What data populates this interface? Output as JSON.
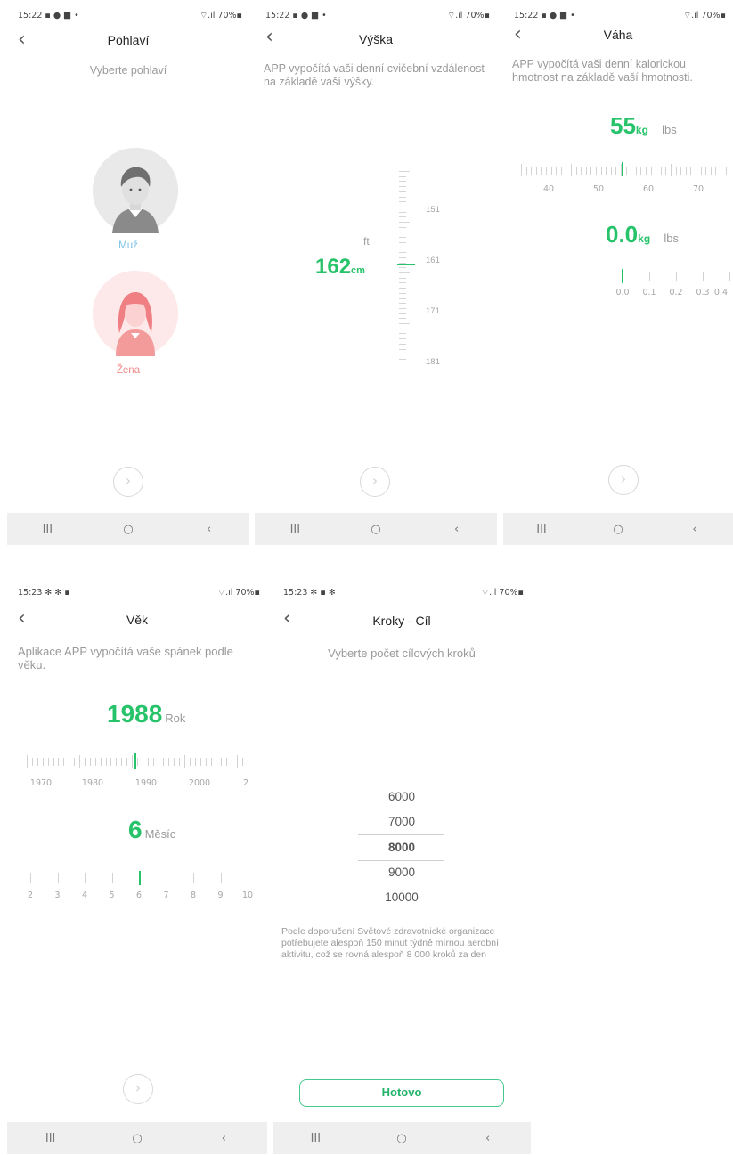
{
  "colors": {
    "accent": "#27c36a",
    "male": "#7fc2e6",
    "female": "#f08a8a",
    "nav_bg": "#efefef"
  },
  "icons": {
    "back": "chevron-left-icon",
    "next": "chevron-right-circle-icon",
    "nav_recent": "recent-apps-icon",
    "nav_home": "home-icon",
    "nav_back": "back-icon"
  },
  "nav": {
    "recent": "III",
    "home": "○",
    "back": "‹"
  },
  "next_glyph": "›",
  "back_glyph": "‹",
  "screens": {
    "gender": {
      "status_time": "15:22 ▪ ● ■ •",
      "status_right": "⌔.ıl 70%▪",
      "title": "Pohlaví",
      "description": "Vyberte pohlaví",
      "male_label": "Muž",
      "female_label": "Žena"
    },
    "height": {
      "status_time": "15:22 ▪ ● ■ •",
      "status_right": "⌔.ıl 70%▪",
      "title": "Výška",
      "description": "APP vypočítá vaši denní cvičební vzdálenost na základě vaší výšky.",
      "unit_alt": "ft",
      "value": "162",
      "unit": "cm",
      "ruler_labels": [
        "151",
        "161",
        "171",
        "181"
      ]
    },
    "weight": {
      "status_time": "15:22 ▪ ● ■ •",
      "status_right": "⌔.ıl 70%▪",
      "title": "Váha",
      "description": "APP vypočítá vaši denní kalorickou hmotnost na základě vaší hmotnosti.",
      "value": "55",
      "unit": "kg",
      "unit_alt": "lbs",
      "ruler_labels": [
        "40",
        "50",
        "60",
        "70"
      ],
      "decimal_value": "0.0",
      "decimal_unit": "kg",
      "decimal_unit_alt": "lbs",
      "decimal_labels": [
        "0.0",
        "0.1",
        "0.2",
        "0.3",
        "0.4"
      ]
    },
    "age": {
      "status_time": "15:23 ✻ ✻ ▪",
      "status_right": "⌔.ıl 70%▪",
      "title": "Věk",
      "description": "Aplikace APP vypočítá vaše spánek podle věku.",
      "year_value": "1988",
      "year_unit": "Rok",
      "year_labels": [
        "1970",
        "1980",
        "1990",
        "2000",
        "2"
      ],
      "month_value": "6",
      "month_unit": "Měsíc",
      "month_labels": [
        "2",
        "3",
        "4",
        "5",
        "6",
        "7",
        "8",
        "9",
        "10"
      ]
    },
    "steps": {
      "status_time": "15:23 ✻ ▪ ✻",
      "status_right": "⌔.ıl 70%▪",
      "title": "Kroky - Cíl",
      "description": "Vyberte počet cílových kroků",
      "options": [
        "6000",
        "7000",
        "8000",
        "9000",
        "10000"
      ],
      "selected": "8000",
      "note": "Podle doporučení Světové zdravotnické organizace potřebujete alespoň 150 minut týdně mírnou aerobní aktivitu, což se rovná alespoň 8 000 kroků za den",
      "done_label": "Hotovo"
    }
  }
}
